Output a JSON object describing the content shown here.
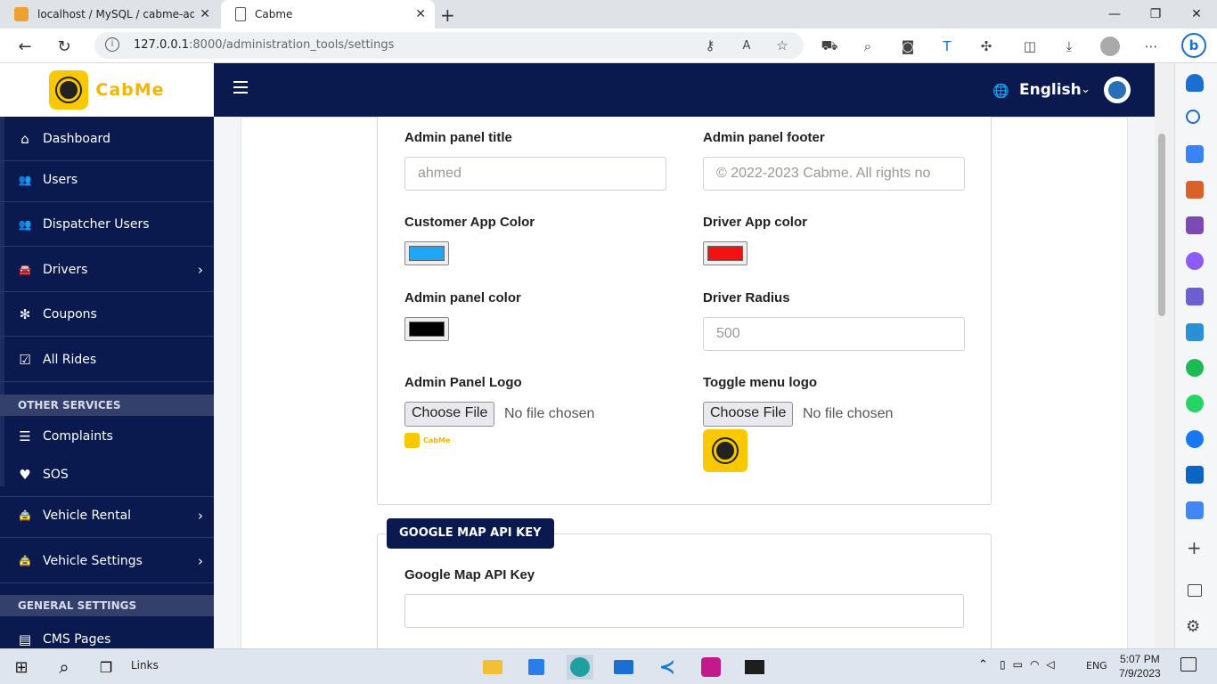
{
  "browser": {
    "tabs": [
      {
        "title": "localhost / MySQL / cabme-admi",
        "favicon": "phpmyadmin-icon"
      },
      {
        "title": "Cabme",
        "favicon": "page-icon"
      }
    ],
    "url_host": "127.0.0.1",
    "url_path": ":8000/administration_tools/settings"
  },
  "brand": {
    "name": "CabMe",
    "color": "#f8b500"
  },
  "topbar": {
    "language": "English",
    "bg_color": "#0a1a4f"
  },
  "sidebar": {
    "items": [
      {
        "label": "Dashboard",
        "icon": "home-icon",
        "glyph": "⌂",
        "chevron": false
      },
      {
        "label": "Users",
        "icon": "users-icon",
        "glyph": "👥",
        "chevron": false
      },
      {
        "label": "Dispatcher Users",
        "icon": "users-icon",
        "glyph": "👥",
        "chevron": false
      },
      {
        "label": "Drivers",
        "icon": "car-icon",
        "glyph": "🚘",
        "chevron": true
      },
      {
        "label": "Coupons",
        "icon": "coupon-icon",
        "glyph": "✻",
        "chevron": false
      },
      {
        "label": "All Rides",
        "icon": "calendar-check-icon",
        "glyph": "☑",
        "chevron": false
      }
    ],
    "section_other": "OTHER SERVICES",
    "other_items": [
      {
        "label": "Complaints",
        "icon": "list-icon",
        "glyph": "☰",
        "chevron": false
      },
      {
        "label": "SOS",
        "icon": "heartbeat-icon",
        "glyph": "♥",
        "chevron": false
      },
      {
        "label": "Vehicle Rental",
        "icon": "car-side-icon",
        "glyph": "🚖",
        "chevron": true
      },
      {
        "label": "Vehicle Settings",
        "icon": "car-side-icon",
        "glyph": "🚖",
        "chevron": true
      }
    ],
    "section_general": "GENERAL SETTINGS",
    "general_items": [
      {
        "label": "CMS Pages",
        "icon": "pages-icon",
        "glyph": "▤",
        "chevron": false
      }
    ]
  },
  "form": {
    "admin_title_label": "Admin panel title",
    "admin_title_value": "ahmed",
    "admin_footer_label": "Admin panel footer",
    "admin_footer_value": "© 2022-2023 Cabme. All rights no",
    "customer_color_label": "Customer App Color",
    "customer_color": "#1ea7f2",
    "driver_color_label": "Driver App color",
    "driver_color": "#f21212",
    "admin_color_label": "Admin panel color",
    "admin_color": "#000000",
    "driver_radius_label": "Driver Radius",
    "driver_radius_value": "500",
    "admin_logo_label": "Admin Panel Logo",
    "toggle_logo_label": "Toggle menu logo",
    "choose_file": "Choose File",
    "no_file": "No file chosen",
    "small_logo_text": "CabMe"
  },
  "google_map": {
    "badge": "GOOGLE MAP API KEY",
    "label": "Google Map API Key",
    "value": ""
  },
  "taskbar": {
    "links_label": "Links",
    "lang": "ENG",
    "time": "5:07 PM",
    "date": "7/9/2023"
  }
}
